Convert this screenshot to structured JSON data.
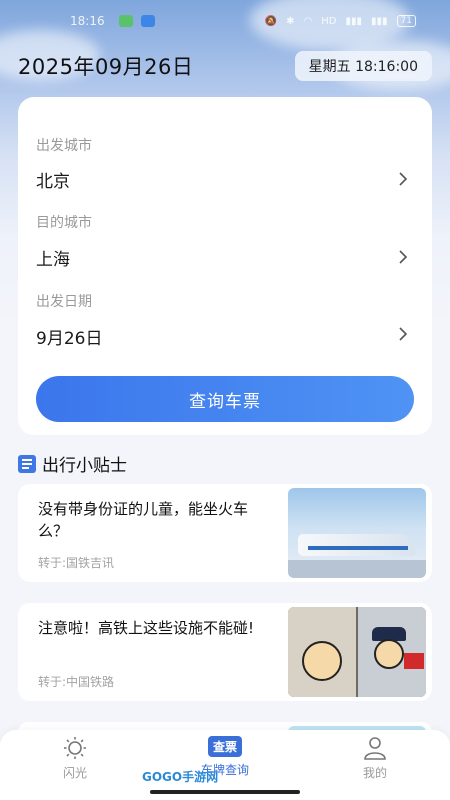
{
  "status_bar": {
    "time": "18:16",
    "battery": "71"
  },
  "header": {
    "date": "2025年09月26日",
    "clock": "星期五 18:16:00"
  },
  "form": {
    "departure_label": "出发城市",
    "departure_value": "北京",
    "destination_label": "目的城市",
    "destination_value": "上海",
    "date_label": "出发日期",
    "date_value": "9月26日",
    "query_button": "查询车票"
  },
  "tips": {
    "title": "出行小贴士",
    "items": [
      {
        "text": "没有带身份证的儿童，能坐火车么？",
        "source": "转于:国铁吉讯"
      },
      {
        "text": "注意啦！高铁上这些设施不能碰!",
        "source": "转于:中国铁路"
      }
    ]
  },
  "tab_bar": {
    "tabs": [
      {
        "label": "闪光",
        "icon": "sun-icon"
      },
      {
        "label": "车牌查询",
        "icon": "ticket-icon",
        "badge": "查票"
      },
      {
        "label": "我的",
        "icon": "user-icon"
      }
    ]
  },
  "watermark": "GOGO手游网",
  "colors": {
    "accent": "#3b76ec",
    "active_tab": "#3a6fd8"
  }
}
